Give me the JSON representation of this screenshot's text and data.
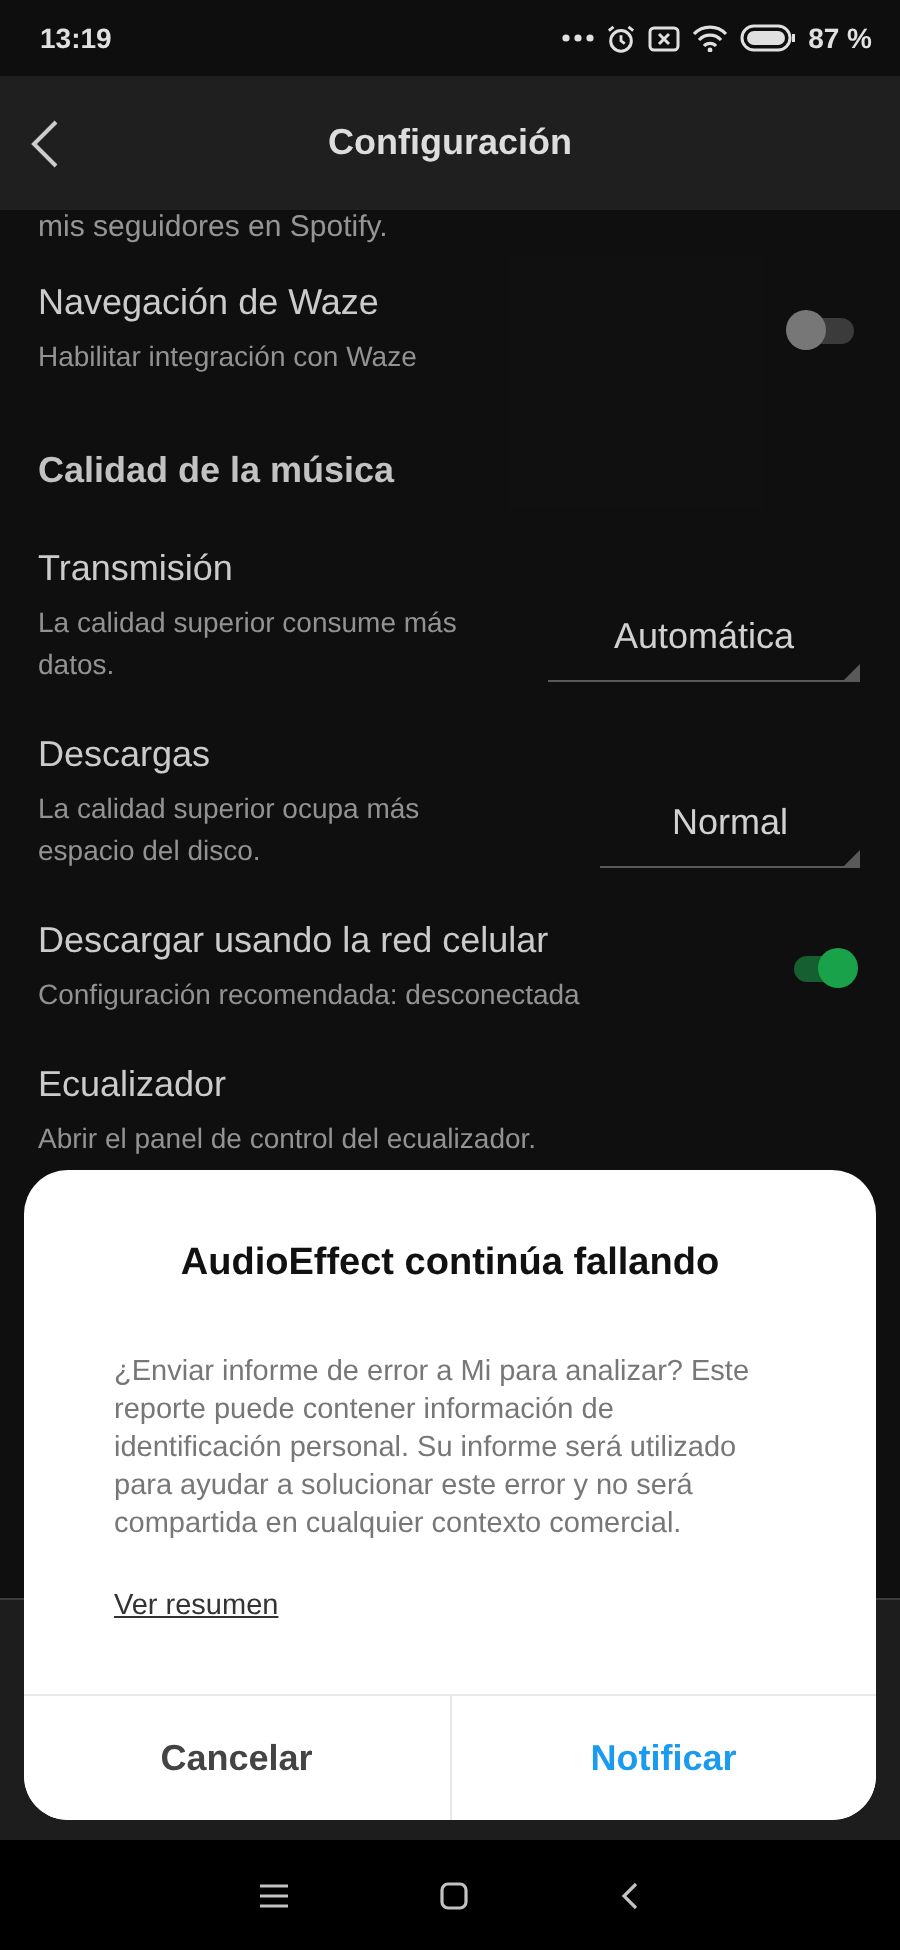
{
  "status_bar": {
    "time": "13:19",
    "battery": "87 %"
  },
  "header": {
    "title": "Configuración"
  },
  "settings": [
    {
      "kind": "text",
      "subtitle": "mis seguidores en Spotify."
    },
    {
      "kind": "toggle",
      "title": "Navegación de Waze",
      "subtitle": "Habilitar integración con Waze",
      "on": false
    },
    {
      "kind": "section",
      "title": "Calidad de la música"
    },
    {
      "kind": "dropdown",
      "title": "Transmisión",
      "subtitle": "La calidad superior consume más datos.",
      "value": "Automática"
    },
    {
      "kind": "dropdown",
      "title": "Descargas",
      "subtitle": "La calidad superior ocupa más espacio del disco.",
      "value": "Normal"
    },
    {
      "kind": "toggle",
      "title": "Descargar usando la red celular",
      "subtitle": "Configuración recomendada: desconectada",
      "on": true
    },
    {
      "kind": "link",
      "title": "Ecualizador",
      "subtitle": "Abrir el panel de control del ecualizador."
    }
  ],
  "dialog": {
    "title": "AudioEffect continúa fallando",
    "message": "¿Enviar informe de error a Mi para analizar? Este reporte puede contener información de identificación personal. Su informe será utilizado para ayudar a solucionar este error y no será compartida en cualquier contexto comercial.",
    "link": "Ver resumen",
    "buttons": [
      {
        "label": "Cancelar",
        "kind": "neutral"
      },
      {
        "label": "Notificar",
        "kind": "primary"
      }
    ]
  }
}
